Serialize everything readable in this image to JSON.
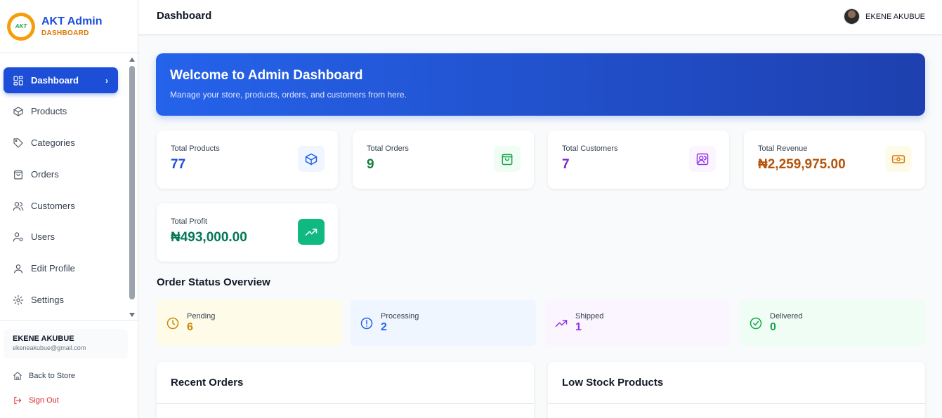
{
  "brand": {
    "logo_text": "AKT",
    "title": "AKT Admin",
    "subtitle": "DASHBOARD"
  },
  "nav": {
    "items": [
      {
        "label": "Dashboard",
        "icon": "dashboard-icon",
        "active": true
      },
      {
        "label": "Products",
        "icon": "box-icon"
      },
      {
        "label": "Categories",
        "icon": "tag-icon"
      },
      {
        "label": "Orders",
        "icon": "shopping-bag-icon"
      },
      {
        "label": "Customers",
        "icon": "users-icon"
      },
      {
        "label": "Users",
        "icon": "user-cog-icon"
      },
      {
        "label": "Edit Profile",
        "icon": "user-icon"
      },
      {
        "label": "Settings",
        "icon": "gear-icon"
      }
    ],
    "active_chevron": "›"
  },
  "sidebar_user": {
    "name": "EKENE AKUBUE",
    "email": "ekeneakubue@gmail.com"
  },
  "sidebar_links": {
    "back": "Back to Store",
    "signout": "Sign Out"
  },
  "header": {
    "title": "Dashboard",
    "user_name": "EKENE AKUBUE"
  },
  "welcome": {
    "title": "Welcome to Admin Dashboard",
    "subtitle": "Manage your store, products, orders, and customers from here."
  },
  "stats": [
    {
      "label": "Total Products",
      "value": "77",
      "color": "#1d4ed8",
      "icon": "cube-icon"
    },
    {
      "label": "Total Orders",
      "value": "9",
      "color": "#15803d",
      "icon": "shopping-bag-icon"
    },
    {
      "label": "Total Customers",
      "value": "7",
      "color": "#7e22ce",
      "icon": "users-icon"
    },
    {
      "label": "Total Revenue",
      "value": "₦2,259,975.00",
      "color": "#b45309",
      "icon": "banknote-icon"
    },
    {
      "label": "Total Profit",
      "value": "₦493,000.00",
      "color": "#047857",
      "icon": "trending-up-icon"
    }
  ],
  "order_status": {
    "title": "Order Status Overview",
    "items": [
      {
        "label": "Pending",
        "value": "6",
        "color": "#ca8a04",
        "icon": "clock-icon"
      },
      {
        "label": "Processing",
        "value": "2",
        "color": "#2563eb",
        "icon": "alert-circle-icon"
      },
      {
        "label": "Shipped",
        "value": "1",
        "color": "#9333ea",
        "icon": "trending-up-icon"
      },
      {
        "label": "Delivered",
        "value": "0",
        "color": "#16a34a",
        "icon": "check-circle-icon"
      }
    ]
  },
  "panels": {
    "recent_orders": "Recent Orders",
    "low_stock": "Low Stock Products"
  }
}
